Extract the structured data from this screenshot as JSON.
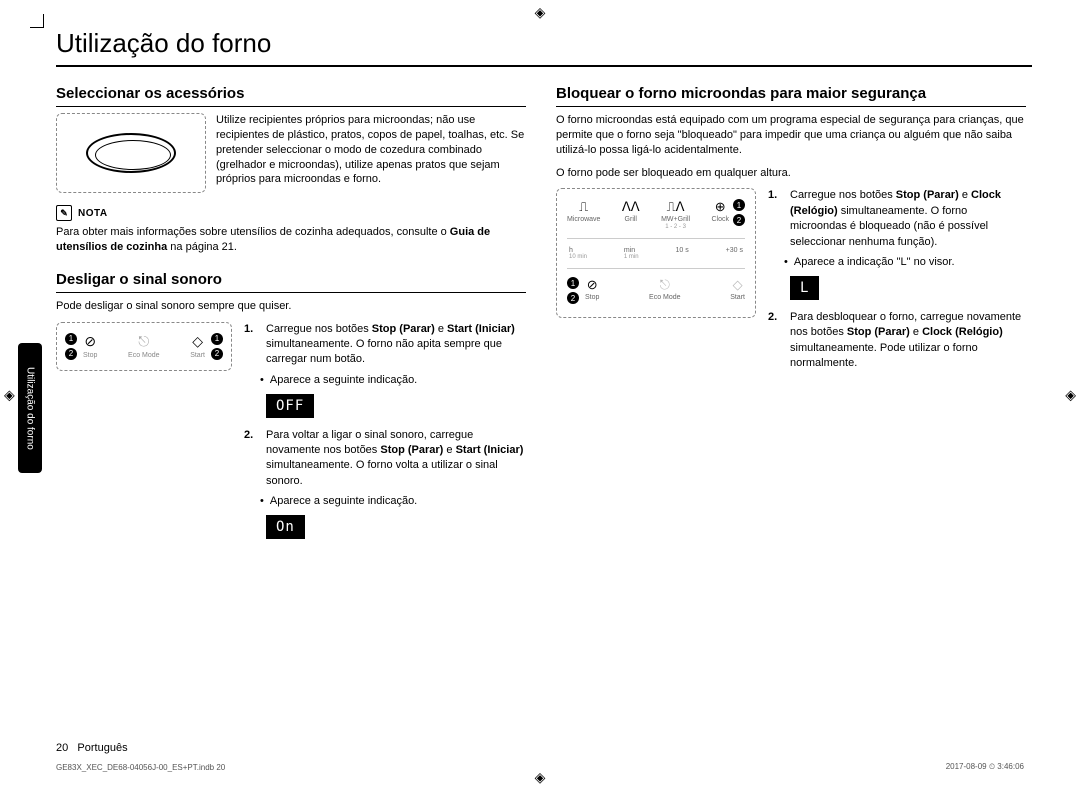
{
  "side_tab": "Utilização do forno",
  "main_title": "Utilização do forno",
  "left": {
    "h_accessories": "Seleccionar os acessórios",
    "accessories_text": "Utilize recipientes próprios para microondas; não use recipientes de plástico, pratos, copos de papel, toalhas, etc. Se pretender seleccionar o modo de cozedura combinado (grelhador e microondas), utilize apenas pratos que sejam próprios para microondas e forno.",
    "nota_label": "NOTA",
    "nota_text_1": "Para obter mais informações sobre utensílios de cozinha adequados, consulte o ",
    "nota_text_bold": "Guia de utensílios de cozinha",
    "nota_text_2": " na página 21.",
    "h_sound": "Desligar o sinal sonoro",
    "sound_intro": "Pode desligar o sinal sonoro sempre que quiser.",
    "panel": {
      "stop": "Stop",
      "eco": "Eco Mode",
      "start": "Start",
      "c1": "1",
      "c2": "2"
    },
    "step1_a": "Carregue nos botões ",
    "step1_b": "Stop (Parar)",
    "step1_c": " e ",
    "step1_d": "Start (Iniciar)",
    "step1_e": " simultaneamente. O forno não apita sempre que carregar num botão.",
    "step1_bullet": "Aparece a seguinte indicação.",
    "display_off": "OFF",
    "step2_a": "Para voltar a ligar o sinal sonoro, carregue novamente nos botões ",
    "step2_b": "Stop (Parar)",
    "step2_c": " e ",
    "step2_d": "Start (Iniciar)",
    "step2_e": " simultaneamente. O forno volta a utilizar o sinal sonoro.",
    "step2_bullet": "Aparece a seguinte indicação.",
    "display_on": "On"
  },
  "right": {
    "h_lock": "Bloquear o forno microondas para maior segurança",
    "intro1": "O forno microondas está equipado com um programa especial de segurança para crianças, que permite que o forno seja \"bloqueado\" para impedir que uma criança ou alguém que não saiba utilizá-lo possa ligá-lo acidentalmente.",
    "intro2": "O forno pode ser bloqueado em qualquer altura.",
    "panel": {
      "microwave": "Microwave",
      "grill": "Grill",
      "mwgrill": "MW+Grill",
      "mwgrill_sub": "1 - 2 - 3",
      "clock": "Clock",
      "h": "h",
      "h_sub": "10 min",
      "min": "min",
      "min_sub": "1 min",
      "ten_s": "10 s",
      "thirty_s": "+30 s",
      "stop": "Stop",
      "eco": "Eco Mode",
      "start": "Start",
      "c1": "1",
      "c2": "2"
    },
    "step1_a": "Carregue nos botões ",
    "step1_b": "Stop (Parar)",
    "step1_c": " e ",
    "step1_d": "Clock (Relógio)",
    "step1_e": " simultaneamente. O forno microondas é bloqueado (não é possível seleccionar nenhuma função).",
    "step1_bullet": "Aparece a indicação \"L\" no visor.",
    "display_L": "L",
    "step2_a": "Para desbloquear o forno, carregue novamente nos botões ",
    "step2_b": "Stop (Parar)",
    "step2_c": " e ",
    "step2_d": "Clock (Relógio)",
    "step2_e": " simultaneamente. Pode utilizar o forno normalmente."
  },
  "footer": {
    "page_num": "20",
    "lang": "Português",
    "print_left": "GE83X_XEC_DE68-04056J-00_ES+PT.indb   20",
    "print_right": "2017-08-09   ⏲ 3:46:06"
  }
}
